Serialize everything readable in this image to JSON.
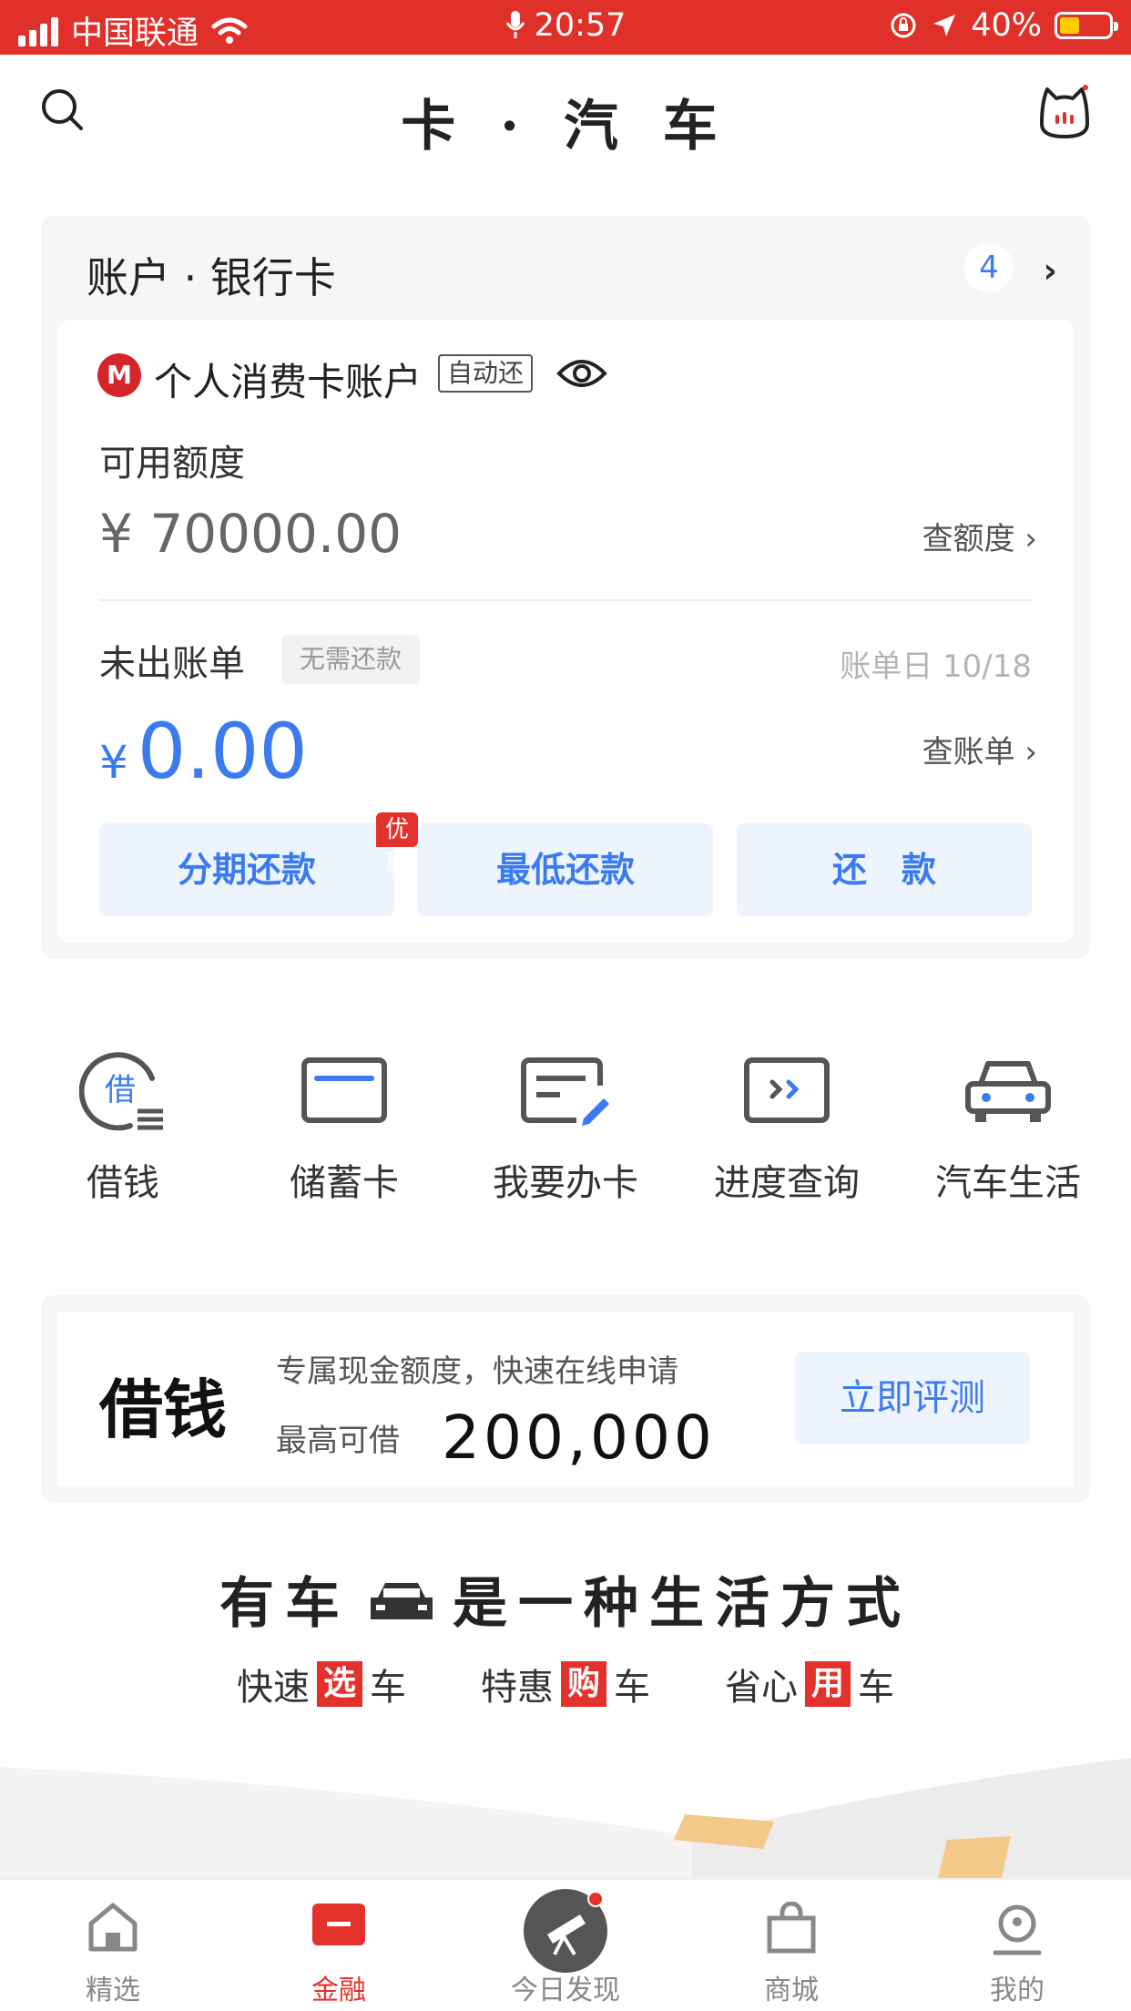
{
  "status_bar": {
    "carrier": "中国联通",
    "time": "20:57",
    "battery_pct": "40%",
    "battery_level": 0.4
  },
  "header": {
    "title": "卡 · 汽 车",
    "left_icon": "search-icon",
    "right_icon": "cat-avatar-icon"
  },
  "account": {
    "section_title": "账户 · 银行卡",
    "card_count": "4",
    "card_name": "个人消费卡账户",
    "auto_tag": "自动还",
    "available_label": "可用额度",
    "available_amount": "¥ 70000.00",
    "check_limit": "查额度 ›",
    "unbilled_label": "未出账单",
    "no_repay_tag": "无需还款",
    "bill_day": "账单日 10/18",
    "bill_currency": "¥",
    "bill_amount": "0.00",
    "check_bill": "查账单 ›",
    "buttons": [
      {
        "label": "分期还款",
        "badge": "优惠"
      },
      {
        "label": "最低还款"
      },
      {
        "label": "还　款"
      }
    ]
  },
  "quick_entries": [
    {
      "label": "借钱",
      "icon": "borrow-icon"
    },
    {
      "label": "储蓄卡",
      "icon": "debit-card-icon"
    },
    {
      "label": "我要办卡",
      "icon": "apply-card-icon"
    },
    {
      "label": "进度查询",
      "icon": "progress-query-icon"
    },
    {
      "label": "汽车生活",
      "icon": "car-icon"
    }
  ],
  "loan_banner": {
    "title": "借钱",
    "desc": "专属现金额度，快速在线申请",
    "max_label": "最高可借",
    "max_amount": "200,000",
    "cta": "立即评测"
  },
  "car_life": {
    "slogan_a": "有车",
    "slogan_b": "是一种生活方式",
    "tags": [
      {
        "pre": "快速",
        "hl": "选",
        "post": "车"
      },
      {
        "pre": "特惠",
        "hl": "购",
        "post": "车"
      },
      {
        "pre": "省心",
        "hl": "用",
        "post": "车"
      }
    ]
  },
  "tab_bar": [
    {
      "label": "精选",
      "icon": "home-icon"
    },
    {
      "label": "金融",
      "icon": "finance-card-icon",
      "active": true
    },
    {
      "label": "今日发现",
      "icon": "telescope-icon"
    },
    {
      "label": "商城",
      "icon": "shopping-bag-icon"
    },
    {
      "label": "我的",
      "icon": "profile-icon"
    }
  ],
  "colors": {
    "brand_red": "#e0302a",
    "accent_blue": "#3a7bf0"
  }
}
